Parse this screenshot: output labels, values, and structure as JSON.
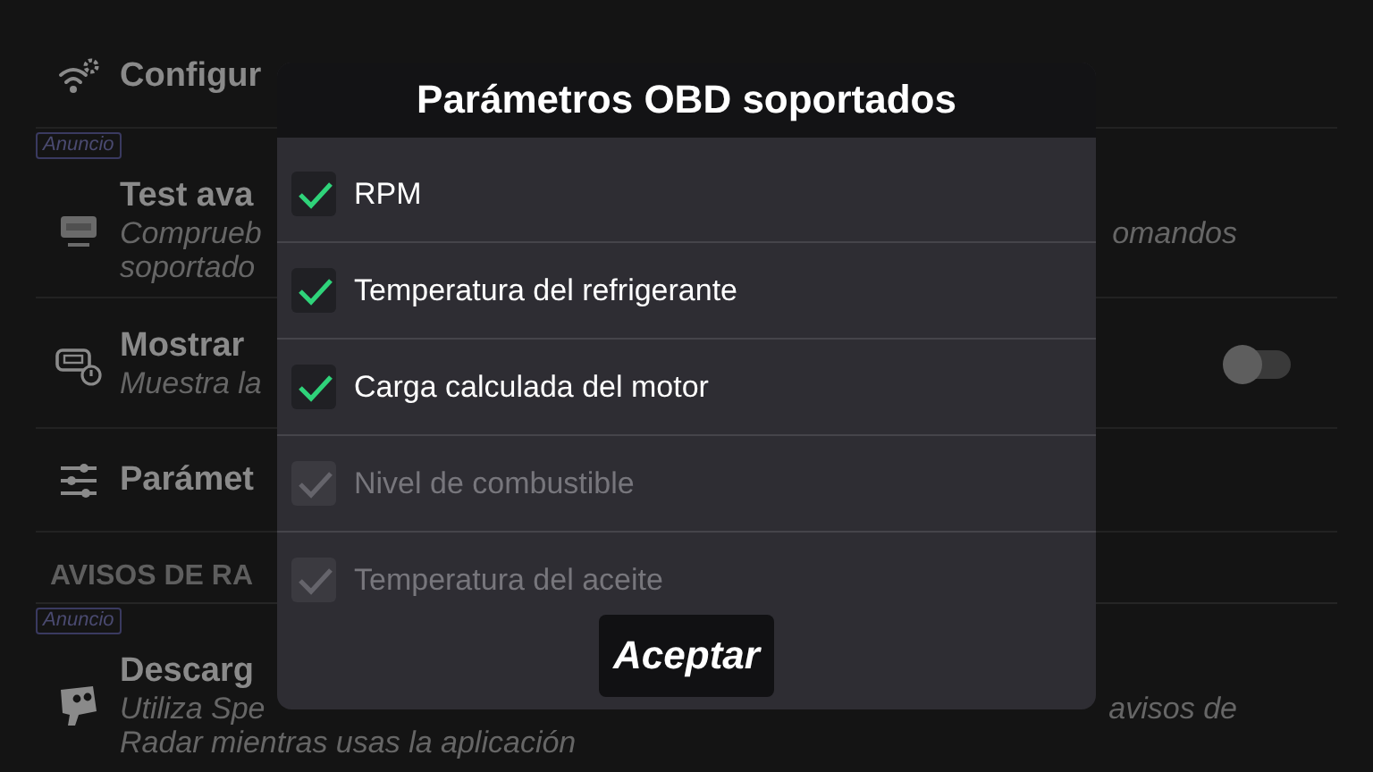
{
  "background": {
    "items": [
      {
        "kind": "setting",
        "title": "Configur"
      },
      {
        "kind": "ad",
        "label": "Anuncio"
      },
      {
        "kind": "setting",
        "title": "Test ava",
        "lines": [
          {
            "left": "Comprueb",
            "right": "omandos"
          },
          {
            "left": "soportado"
          }
        ]
      },
      {
        "kind": "setting",
        "title": "Mostrar",
        "lines": [
          {
            "left": "Muestra la"
          }
        ],
        "toggle": {
          "on": false
        }
      },
      {
        "kind": "setting",
        "title": "Parámet"
      },
      {
        "kind": "header",
        "label": "AVISOS DE RA"
      },
      {
        "kind": "ad",
        "label": "Anuncio"
      },
      {
        "kind": "setting",
        "title": "Descarg",
        "lines": [
          {
            "left": "Utiliza Spe",
            "right": "avisos de"
          },
          {
            "left": "Radar mientras usas la aplicación"
          }
        ]
      }
    ]
  },
  "dialog": {
    "title": "Parámetros OBD soportados",
    "items": [
      {
        "label": "RPM",
        "checked": true,
        "disabled": false
      },
      {
        "label": "Temperatura del refrigerante",
        "checked": true,
        "disabled": false
      },
      {
        "label": "Carga calculada del motor",
        "checked": true,
        "disabled": false
      },
      {
        "label": "Nivel de combustible",
        "checked": true,
        "disabled": true
      },
      {
        "label": "Temperatura del aceite",
        "checked": true,
        "disabled": true
      }
    ],
    "button": "Aceptar"
  }
}
